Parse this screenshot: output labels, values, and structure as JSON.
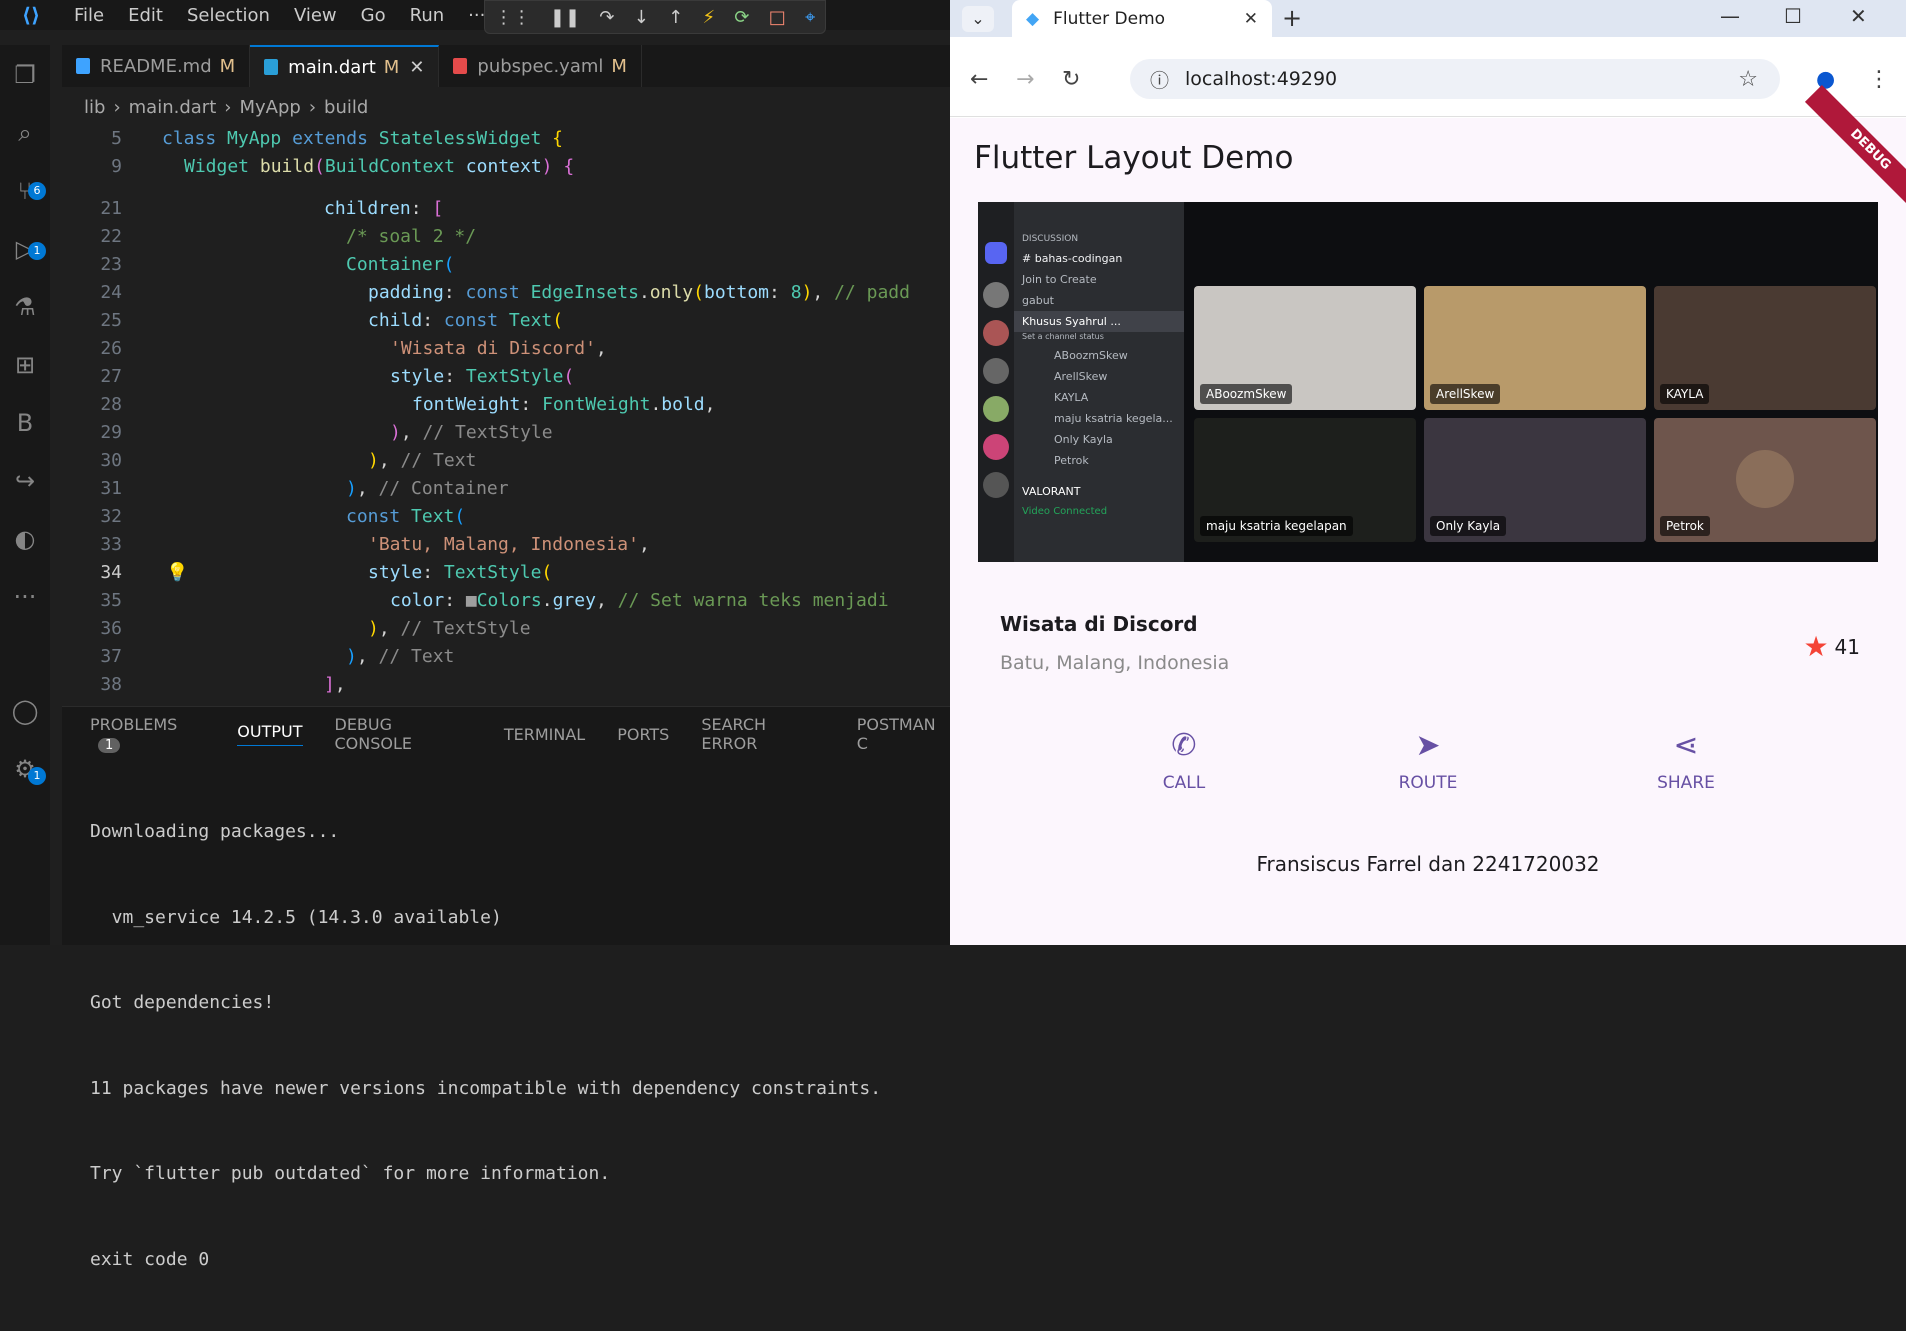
{
  "vscode": {
    "menu": [
      "File",
      "Edit",
      "Selection",
      "View",
      "Go",
      "Run",
      "···"
    ],
    "tabs": [
      {
        "label": "README.md",
        "mod": "M"
      },
      {
        "label": "main.dart",
        "mod": "M"
      },
      {
        "label": "pubspec.yaml",
        "mod": "M"
      }
    ],
    "breadcrumb": [
      "lib",
      "main.dart",
      "MyApp",
      "build"
    ],
    "badges": {
      "scm": "6",
      "debug": "1",
      "settings": "1"
    },
    "panel_tabs": [
      "PROBLEMS",
      "OUTPUT",
      "DEBUG CONSOLE",
      "TERMINAL",
      "PORTS",
      "SEARCH ERROR",
      "POSTMAN C"
    ],
    "problems_count": "1",
    "output_lines": [
      "Downloading packages...",
      "  vm_service 14.2.5 (14.3.0 available)",
      "Got dependencies!",
      "11 packages have newer versions incompatible with dependency constraints.",
      "Try `flutter pub outdated` for more information.",
      "exit code 0"
    ]
  },
  "browser": {
    "tab_title": "Flutter Demo",
    "url": "localhost:49290"
  },
  "app": {
    "title": "Flutter Layout Demo",
    "debug_label": "DEBUG",
    "place_title": "Wisata di Discord",
    "place_location": "Batu, Malang, Indonesia",
    "rating": "41",
    "actions": [
      "CALL",
      "ROUTE",
      "SHARE"
    ],
    "footer": "Fransiscus Farrel dan 2241720032"
  },
  "discord": {
    "channels": [
      "DISCUSSION",
      "# bahas-codingan",
      "Join to Create",
      "gabut",
      "Khusus Syahrul ...",
      "Set a channel status",
      "ABoozmSkew",
      "ArellSkew",
      "KAYLA",
      "maju ksatria kegela...",
      "Only Kayla",
      "Petrok",
      "VALORANT",
      "Video Connected"
    ],
    "tiles": [
      "ABoozmSkew",
      "ArellSkew",
      "KAYLA",
      "maju ksatria kegelapan",
      "Only Kayla",
      "Petrok"
    ]
  }
}
